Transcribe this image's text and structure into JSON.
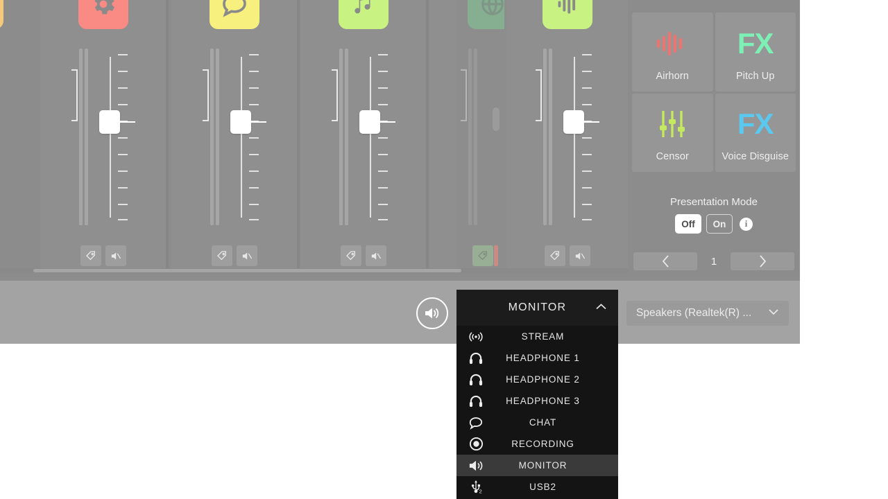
{
  "app": {
    "mixer": {
      "channels": [
        {
          "name": "channel-partial-left",
          "icon": "orange-icon",
          "icon_color": "#f5c97a",
          "partial": true
        },
        {
          "name": "channel-system",
          "icon": "gear-icon",
          "icon_color": "#f98b84",
          "fader_value": 50,
          "buttons": [
            "tag-icon",
            "mute-icon"
          ]
        },
        {
          "name": "channel-chat",
          "icon": "chat-bubble-icon",
          "icon_color": "#f7f07f",
          "fader_value": 50,
          "buttons": [
            "tag-icon",
            "mute-icon"
          ]
        },
        {
          "name": "channel-music",
          "icon": "music-note-icon",
          "icon_color": "#c8f383",
          "fader_value": 50,
          "buttons": [
            "tag-icon",
            "mute-icon"
          ]
        },
        {
          "name": "channel-browser",
          "icon": "globe-icon",
          "icon_color": "#7fd99a",
          "fader_value": 50,
          "buttons": [
            "tag-icon"
          ],
          "dimmed": true
        },
        {
          "name": "channel-aux",
          "icon": "waveform-icon",
          "icon_color": "#c8f383",
          "fader_value": 50,
          "buttons": [
            "tag-icon",
            "mute-icon"
          ]
        }
      ]
    },
    "fx": {
      "buttons": [
        {
          "label": "Airhorn",
          "art": "waveform-bars-icon",
          "color": "#f4726e"
        },
        {
          "label": "Pitch Up",
          "art": "FX",
          "color": "#7df0b6"
        },
        {
          "label": "Censor",
          "art": "sliders-icon",
          "color": "#c4e860"
        },
        {
          "label": "Voice Disguise",
          "art": "FX",
          "color": "#5ac8ef"
        }
      ],
      "presentation_mode": {
        "title": "Presentation Mode",
        "off_label": "Off",
        "on_label": "On",
        "selected": "Off",
        "info_glyph": "i"
      },
      "pagination": {
        "prev_glyph": "‹",
        "next_glyph": "›",
        "page": "1"
      }
    },
    "bottom_bar": {
      "monitor_icon": "speaker-volume-icon",
      "device_select": {
        "value": "Speakers (Realtek(R) ...",
        "caret": "chevron-down-icon"
      }
    },
    "dropdown": {
      "header": "MONITOR",
      "caret": "chevron-up-icon",
      "selected": "MONITOR",
      "items": [
        {
          "label": "STREAM",
          "icon": "broadcast-icon"
        },
        {
          "label": "HEADPHONE 1",
          "icon": "headphone-icon"
        },
        {
          "label": "HEADPHONE 2",
          "icon": "headphone-icon"
        },
        {
          "label": "HEADPHONE 3",
          "icon": "headphone-icon"
        },
        {
          "label": "CHAT",
          "icon": "chat-bubble-icon"
        },
        {
          "label": "RECORDING",
          "icon": "record-dot-icon"
        },
        {
          "label": "MONITOR",
          "icon": "speaker-volume-icon"
        },
        {
          "label": "USB2",
          "icon": "usb-icon"
        }
      ]
    }
  }
}
